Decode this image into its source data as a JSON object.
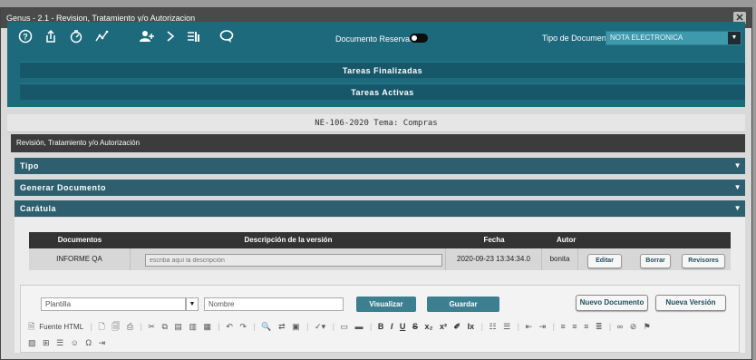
{
  "window": {
    "title": "Genus - 2.1 - Revision, Tratamiento y/o Autorizacion",
    "close": "✕"
  },
  "toolbar": {
    "icons": [
      "help-icon",
      "upload-icon",
      "timer-icon",
      "chart-line-icon",
      "add-user-icon",
      "chevron-right-icon",
      "list-icon",
      "chat-icon"
    ],
    "reservado_label": "Documento Reservado:",
    "tipo_label": "Tipo de Documento:",
    "tipo_value": "NOTA ELECTRONICA"
  },
  "bars": {
    "finalizadas": "Tareas Finalizadas",
    "activas": "Tareas Activas"
  },
  "ne_title": "NE-106-2020 Tema: Compras",
  "revision_header": "Revisión, Tratamiento y/o Autorización",
  "sections": {
    "tipo": "Tipo",
    "generar": "Generar Documento",
    "caratula": "Carátula"
  },
  "table": {
    "headers": [
      "Documentos",
      "Descripción de la versión",
      "Fecha",
      "Autor"
    ],
    "row": {
      "documento": "INFORME QA",
      "descripcion_placeholder": "escriba aquí la descripción",
      "fecha": "2020-09-23 13:34:34.0",
      "autor": "bonita"
    },
    "actions": [
      "Editar",
      "Borrar",
      "Revisores"
    ]
  },
  "editor": {
    "plantilla_placeholder": "Plantilla",
    "nombre_placeholder": "Nombre",
    "visualizar": "Visualizar",
    "guardar": "Guardar",
    "nuevo_documento": "Nuevo Documento",
    "nueva_version": "Nueva Versión",
    "fuente_html": "Fuente HTML"
  },
  "colors": {
    "toolbar": "#1e6a7d",
    "bar": "#17576a",
    "section": "#2d5f6e",
    "header": "#3c3c3c"
  }
}
